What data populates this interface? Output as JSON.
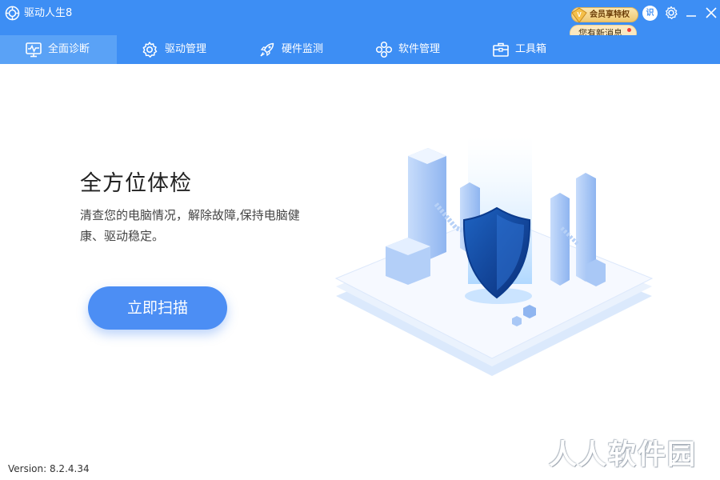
{
  "app": {
    "title": "驱动人生8",
    "version_text": "Version:  8.2.4.34"
  },
  "header": {
    "vip_label": "会员享特权",
    "message_label": "您有新消息",
    "user_avatar_text": "识"
  },
  "nav": {
    "items": [
      {
        "label": "全面诊断",
        "icon": "monitor-pulse-icon",
        "active": true
      },
      {
        "label": "驱动管理",
        "icon": "gear-icon",
        "active": false
      },
      {
        "label": "硬件监测",
        "icon": "rocket-icon",
        "active": false
      },
      {
        "label": "软件管理",
        "icon": "apps-flower-icon",
        "active": false
      },
      {
        "label": "工具箱",
        "icon": "toolbox-icon",
        "active": false
      }
    ]
  },
  "main": {
    "title": "全方位体检",
    "description": "清查您的电脑情况，解除故障,保持电脑健康、驱动稳定。",
    "scan_button": "立即扫描"
  },
  "watermark": "人人软件园",
  "colors": {
    "primary": "#3d8ef4",
    "active_tab": "#5aa2f6",
    "button": "#4c8ef4",
    "vip_gold": "#efc76f"
  }
}
